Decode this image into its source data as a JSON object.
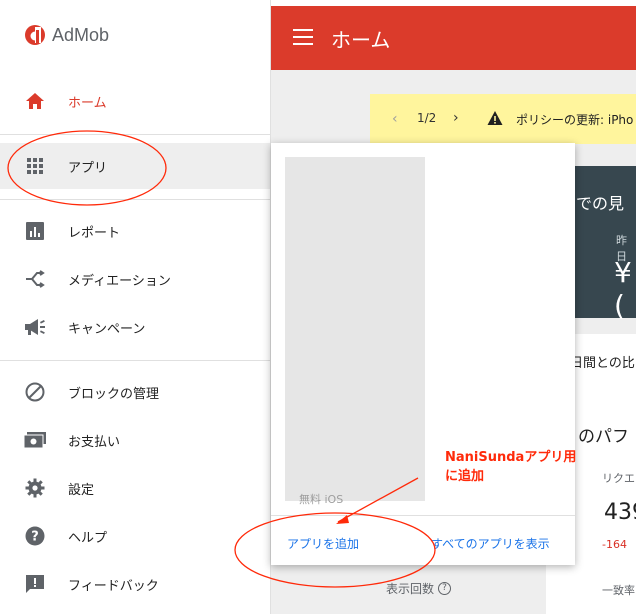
{
  "app": {
    "logo_text": "AdMob"
  },
  "header": {
    "title": "ホーム"
  },
  "sidebar": {
    "items": [
      {
        "label": "ホーム",
        "icon": "home-icon"
      },
      {
        "label": "アプリ",
        "icon": "apps-grid-icon"
      },
      {
        "label": "レポート",
        "icon": "bar-chart-icon"
      },
      {
        "label": "メディエーション",
        "icon": "mediation-icon"
      },
      {
        "label": "キャンペーン",
        "icon": "megaphone-icon"
      },
      {
        "label": "ブロックの管理",
        "icon": "block-icon"
      },
      {
        "label": "お支払い",
        "icon": "payments-icon"
      },
      {
        "label": "設定",
        "icon": "gear-icon"
      },
      {
        "label": "ヘルプ",
        "icon": "help-icon"
      },
      {
        "label": "フィードバック",
        "icon": "feedback-icon"
      }
    ]
  },
  "policy_banner": {
    "page": "1/2",
    "text": "ポリシーの更新: iPho"
  },
  "dark_card": {
    "title": "での見",
    "sub": "昨日",
    "value": "¥("
  },
  "white_card": {
    "row1": "日間との比",
    "perf": "のパフ",
    "requests_label": "リクエ",
    "requests_value": "439",
    "delta": "-164",
    "match_label": "一致率"
  },
  "impressions_label": "表示回数",
  "popup": {
    "hidden_text": "無料 iOS",
    "add_app": "アプリを追加",
    "all_apps": "すべてのアプリを表示"
  },
  "annotation": {
    "line1": "NaniSundaアプリ用",
    "line2": "に追加"
  },
  "colors": {
    "brand_red": "#db3b2b",
    "banner_yellow": "#fff59d",
    "link_blue": "#1a73e8",
    "annotation_red": "#ff2a0a"
  }
}
